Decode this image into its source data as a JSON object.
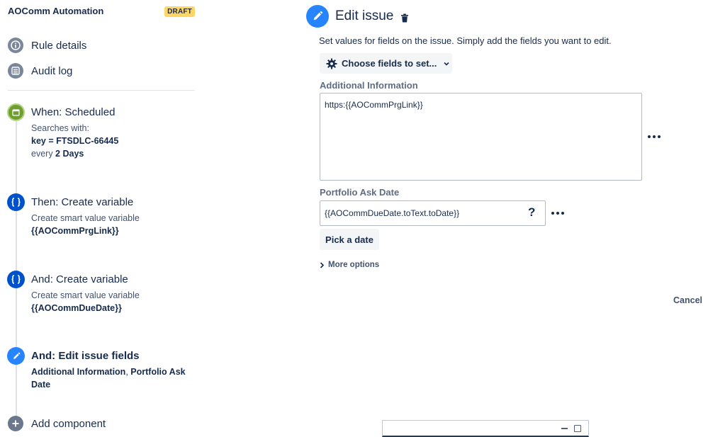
{
  "sidebar": {
    "rule_title": "AOComm Automation",
    "status_badge": "DRAFT",
    "nav": [
      {
        "label": "Rule details",
        "icon": "info-icon"
      },
      {
        "label": "Audit log",
        "icon": "list-icon"
      }
    ],
    "components": [
      {
        "title": "When: Scheduled",
        "icon": "calendar-icon",
        "desc_intro": "Searches with:",
        "query_key": "key",
        "query_op": " = ",
        "query_value": "FTSDLC-66445",
        "schedule_prefix": "every ",
        "schedule_value": "2 Days"
      },
      {
        "title": "Then: Create variable",
        "icon": "braces-icon",
        "desc": "Create smart value variable",
        "detail": "{{AOCommPrgLink}}"
      },
      {
        "title": "And: Create variable",
        "icon": "braces-icon",
        "desc": "Create smart value variable",
        "detail": "{{AOCommDueDate}}"
      },
      {
        "title": "And: Edit issue fields",
        "icon": "pencil-icon",
        "detail_part1": "Additional Information",
        "detail_sep": ", ",
        "detail_part2": "Portfolio Ask Date"
      }
    ],
    "add_component": "Add component"
  },
  "main": {
    "title": "Edit issue",
    "description": "Set values for fields on the issue. Simply add the fields you want to edit.",
    "choose_fields_label": "Choose fields to set...",
    "fields": [
      {
        "label": "Additional Information",
        "value": "https:{{AOCommPrgLink}}"
      },
      {
        "label": "Portfolio Ask Date",
        "value": "{{AOCommDueDate.toText.toDate}}",
        "help": "?"
      }
    ],
    "pick_date_label": "Pick a date",
    "more_options_label": "More options",
    "cancel_label": "Cancel"
  },
  "colors": {
    "accent": "#2684ff",
    "scheduled": "#6e9e2d",
    "variable": "#0052cc",
    "draft_badge": "#ffd666"
  }
}
